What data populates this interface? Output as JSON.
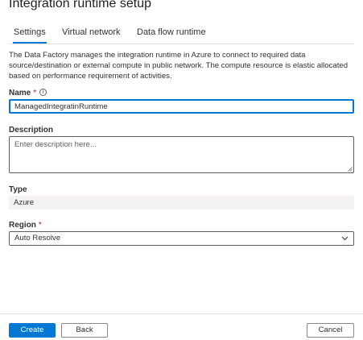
{
  "panel": {
    "title": "Integration runtime setup"
  },
  "tabs": [
    {
      "label": "Settings",
      "active": true
    },
    {
      "label": "Virtual network",
      "active": false
    },
    {
      "label": "Data flow runtime",
      "active": false
    }
  ],
  "description_text": "The Data Factory manages the integration runtime in Azure to connect to required data source/destination or external compute in public network. The compute resource is elastic allocated based on performance requirement of activities.",
  "fields": {
    "name": {
      "label": "Name",
      "required_marker": "*",
      "info_icon": "info-icon",
      "value": "ManagedIntegratinRuntime"
    },
    "description": {
      "label": "Description",
      "placeholder": "Enter description here..."
    },
    "type": {
      "label": "Type",
      "value": "Azure"
    },
    "region": {
      "label": "Region",
      "required_marker": "*",
      "selected": "Auto Resolve",
      "icon": "chevron-down-icon"
    }
  },
  "footer": {
    "create_label": "Create",
    "back_label": "Back",
    "cancel_label": "Cancel"
  },
  "colors": {
    "accent": "#0078d4",
    "required": "#a4262c",
    "readonly_bg": "#f3f2f1",
    "border": "#605e5c"
  }
}
